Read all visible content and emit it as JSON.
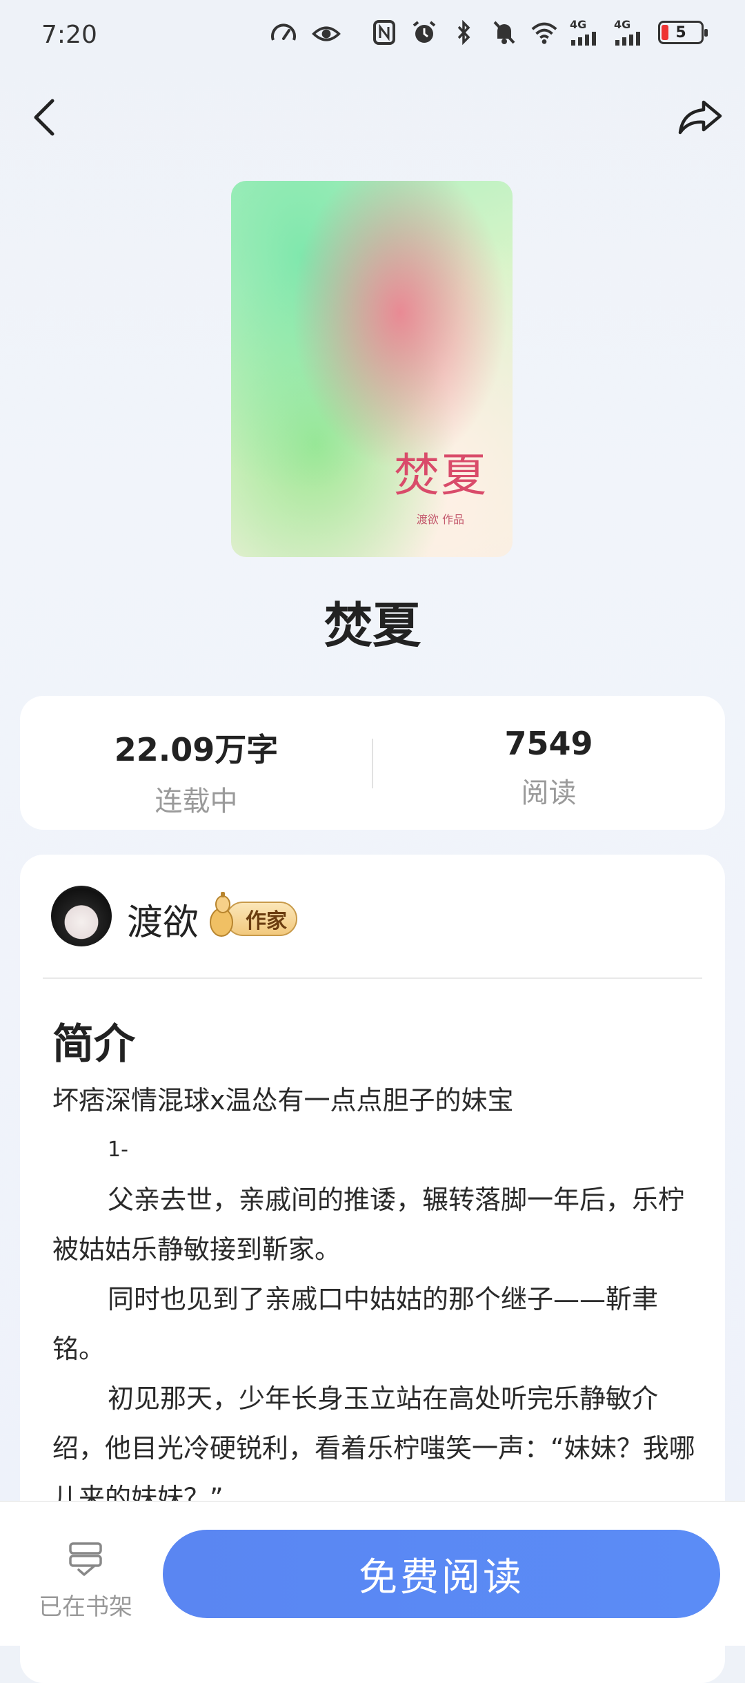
{
  "status_bar": {
    "time": "7:20",
    "signal_labels": [
      "4G",
      "4G"
    ],
    "battery": "5"
  },
  "book": {
    "cover_title": "焚夏",
    "cover_subtitle": "渡欲 作品",
    "title": "焚夏"
  },
  "stats": {
    "words_value": "22.09万字",
    "words_label": "连载中",
    "reads_value": "7549",
    "reads_label": "阅读"
  },
  "author": {
    "name": "渡欲",
    "badge": "作家"
  },
  "intro": {
    "heading": "简介",
    "tagline": "坏痞深情混球x温怂有一点点胆子的妹宝",
    "marker": "1-",
    "para1": "父亲去世，亲戚间的推诿，辗转落脚一年后，乐柠被姑姑乐静敏接到靳家。",
    "para2": "同时也见到了亲戚口中姑姑的那个继子——靳聿铭。",
    "para3": "初见那天，少年长身玉立站在高处听完乐静敏介绍，他目光冷硬锐利，看着乐柠嗤笑一声：“妹妹？我哪儿来的妹妹？”"
  },
  "bottom": {
    "shelf_label": "已在书架",
    "read_button": "免费阅读"
  },
  "colors": {
    "accent": "#5b8cf6",
    "badge": "#f2c97e"
  }
}
